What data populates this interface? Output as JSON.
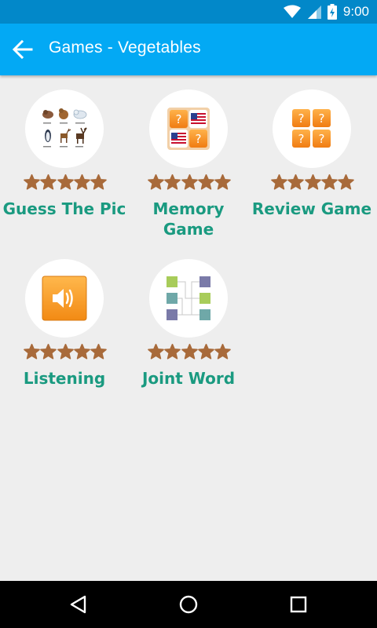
{
  "status_bar": {
    "time": "9:00",
    "icons": [
      "wifi-icon",
      "cell-signal-icon",
      "battery-charging-icon"
    ]
  },
  "app_bar": {
    "back_icon": "arrow-back-icon",
    "title": "Games - Vegetables"
  },
  "games": [
    {
      "label": "Guess The Pic",
      "icon": "animals-collage-icon",
      "rating": 5
    },
    {
      "label": "Memory Game",
      "icon": "memory-cards-icon",
      "rating": 5
    },
    {
      "label": "Review Game",
      "icon": "question-cards-icon",
      "rating": 5
    },
    {
      "label": "Listening",
      "icon": "speaker-icon",
      "rating": 5
    },
    {
      "label": "Joint Word",
      "icon": "match-columns-icon",
      "rating": 5
    }
  ],
  "nav_bar": {
    "icons": [
      "back-triangle-icon",
      "home-circle-icon",
      "recents-square-icon"
    ]
  },
  "colors": {
    "status_bar": "#0288c9",
    "app_bar": "#03a9f4",
    "label": "#1a9a80",
    "star": "#a86a3a",
    "background": "#eeeeee"
  }
}
